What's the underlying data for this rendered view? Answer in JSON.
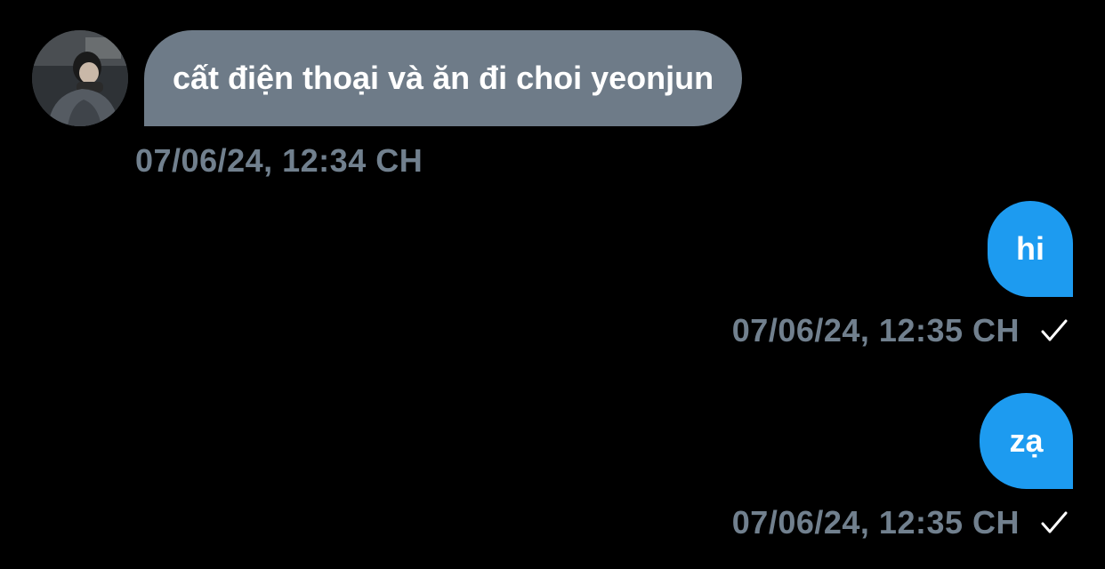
{
  "messages": [
    {
      "direction": "incoming",
      "text": "cất điện thoại và ăn đi choi yeonjun",
      "timestamp": "07/06/24, 12:34 CH"
    },
    {
      "direction": "outgoing",
      "text": "hi",
      "timestamp": "07/06/24, 12:35 CH",
      "status_icon": "checkmark-icon"
    },
    {
      "direction": "outgoing",
      "text": "zạ",
      "timestamp": "07/06/24, 12:35 CH",
      "status_icon": "checkmark-icon"
    }
  ],
  "colors": {
    "background": "#000000",
    "incoming_bubble": "#6e7b88",
    "outgoing_bubble": "#1d9bf0",
    "timestamp_text": "#71808e",
    "message_text": "#ffffff"
  }
}
